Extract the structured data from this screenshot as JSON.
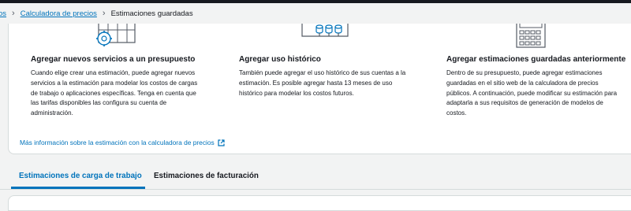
{
  "breadcrumb": {
    "first": "os",
    "calculator": "Calculadora de precios",
    "current": "Estimaciones guardadas"
  },
  "features": [
    {
      "icon": "gear-grid-icon",
      "title": "Agregar nuevos servicios a un presupuesto",
      "body": "Cuando elige crear una estimación, puede agregar nuevos servicios a la estimación para modelar los costos de cargas de trabajo o aplicaciones específicas. Tenga en cuenta que las tarifas disponibles las configura su cuenta de administración."
    },
    {
      "icon": "historical-usage-icon",
      "title": "Agregar uso histórico",
      "body": "También puede agregar el uso histórico de sus cuentas a la estimación. Es posible agregar hasta 13 meses de uso histórico para modelar los costos futuros."
    },
    {
      "icon": "calculator-icon",
      "title": "Agregar estimaciones guardadas anteriormente",
      "body": "Dentro de su presupuesto, puede agregar estimaciones guardadas en el sitio web de la calculadora de precios públicos. A continuación, puede modificar su estimación para adaptarla a sus requisitos de generación de modelos de costos."
    }
  ],
  "more_link": "Más información sobre la estimación con la calculadora de precios",
  "tabs": [
    {
      "label": "Estimaciones de carga de trabajo",
      "active": true
    },
    {
      "label": "Estimaciones de facturación",
      "active": false
    }
  ],
  "colors": {
    "link": "#0073bb",
    "text": "#16191f",
    "background": "#f2f3f3",
    "border": "#d5dbdb",
    "icon_stroke": "#545b64",
    "icon_accent": "#0073bb"
  }
}
